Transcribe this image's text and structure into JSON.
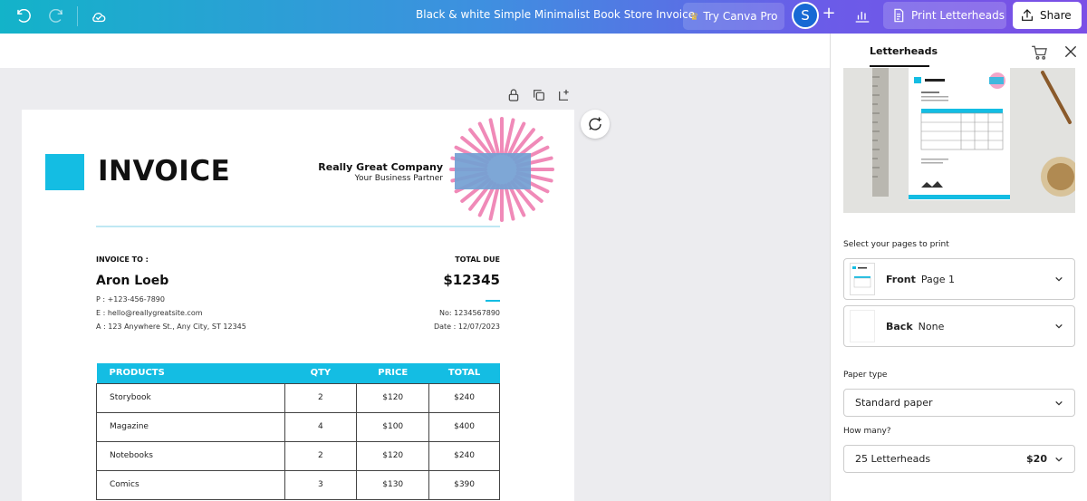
{
  "topbar": {
    "doc_title": "Black & white Simple Minimalist Book Store Invoice",
    "try_pro_label": "Try Canva Pro",
    "avatar_letter": "S",
    "plus_label": "+",
    "print_label": "Print Letterheads",
    "share_label": "Share"
  },
  "invoice": {
    "title": "INVOICE",
    "company": "Really Great Company",
    "tagline": "Your Business Partner",
    "to_label": "INVOICE TO :",
    "client_name": "Aron Loeb",
    "phone": "P : +123-456-7890",
    "email": "E : hello@reallygreatsite.com",
    "address": "A : 123 Anywhere St., Any City, ST 12345",
    "total_label": "TOTAL DUE",
    "total_amount": "$12345",
    "number": "No: 1234567890",
    "date": "Date : 12/07/2023",
    "table": {
      "headers": [
        "PRODUCTS",
        "QTY",
        "PRICE",
        "TOTAL"
      ],
      "rows": [
        [
          "Storybook",
          "2",
          "$120",
          "$240"
        ],
        [
          "Magazine",
          "4",
          "$100",
          "$400"
        ],
        [
          "Notebooks",
          "2",
          "$120",
          "$240"
        ],
        [
          "Comics",
          "3",
          "$130",
          "$390"
        ]
      ]
    }
  },
  "panel": {
    "tab_label": "Letterheads",
    "pages_label": "Select your pages to print",
    "front": {
      "label": "Front",
      "value": "Page 1"
    },
    "back": {
      "label": "Back",
      "value": "None"
    },
    "paper_label": "Paper type",
    "paper_value": "Standard paper",
    "howmany_label": "How many?",
    "quantity_value": "25 Letterheads",
    "price": "$20"
  },
  "colors": {
    "accent": "#14bde3",
    "topbar_start": "#13b3c9",
    "topbar_end": "#7b4fe6"
  }
}
